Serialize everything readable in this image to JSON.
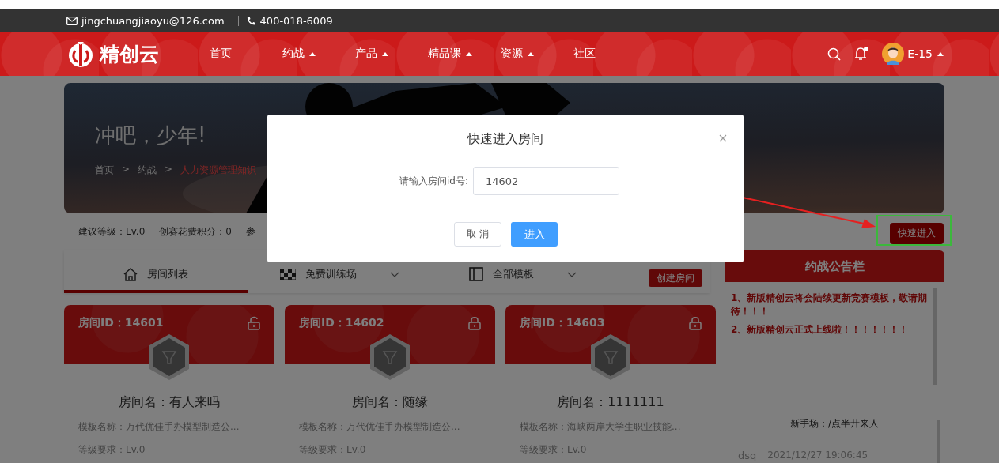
{
  "contact": {
    "email": "jingchuangjiaoyu@126.com",
    "phone": "400-018-6009"
  },
  "brand": "精创云",
  "nav": [
    {
      "label": "首页",
      "dropdown": false
    },
    {
      "label": "约战",
      "dropdown": true
    },
    {
      "label": "产品",
      "dropdown": true
    },
    {
      "label": "精品课",
      "dropdown": true
    },
    {
      "label": "资源",
      "dropdown": true
    },
    {
      "label": "社区",
      "dropdown": false
    }
  ],
  "user": {
    "name": "E-15",
    "notification": true
  },
  "hero": {
    "title": "冲吧，少年!",
    "breadcrumb": [
      {
        "label": "首页",
        "current": false
      },
      {
        "label": "约战",
        "current": false
      },
      {
        "label": "人力资源管理知识",
        "current": true
      }
    ],
    "separator": ">"
  },
  "info": [
    "建议等级：Lv.0",
    "创赛花费积分：0",
    "参"
  ],
  "quick_enter": "快速进入",
  "tabs": [
    {
      "label": "房间列表",
      "selected": true,
      "dropdown": false
    },
    {
      "label": "免费训练场",
      "selected": false,
      "dropdown": true
    },
    {
      "label": "全部模板",
      "selected": false,
      "dropdown": true
    }
  ],
  "create_room": "创建房间",
  "rooms": [
    {
      "id_label": "房间ID：14601",
      "locked": false,
      "name": "房间名：有人来吗",
      "template": "模板名称：万代优佳手办模型制造公...",
      "level": "等级要求：Lv.0"
    },
    {
      "id_label": "房间ID：14602",
      "locked": true,
      "name": "房间名：随缘",
      "template": "模板名称：万代优佳手办模型制造公...",
      "level": "等级要求：Lv.0"
    },
    {
      "id_label": "房间ID：14603",
      "locked": true,
      "name": "房间名：1111111",
      "template": "模板名称：海峡两岸大学生职业技能...",
      "level": "等级要求：Lv.0"
    }
  ],
  "notice": {
    "title": "约战公告栏",
    "items": [
      "1、新版精创云将会陆续更新竞赛模板，敬请期待！！！",
      "2、新版精创云正式上线啦！！！！！！！"
    ]
  },
  "chat": {
    "title": "新手场：/点半廾来人",
    "messages": [
      {
        "user": "dsq",
        "time": "2021/12/27 19:06:45"
      }
    ]
  },
  "modal": {
    "title": "快速进入房间",
    "label": "请输入房间id号:",
    "value": "14602",
    "cancel": "取 消",
    "confirm": "进入"
  }
}
